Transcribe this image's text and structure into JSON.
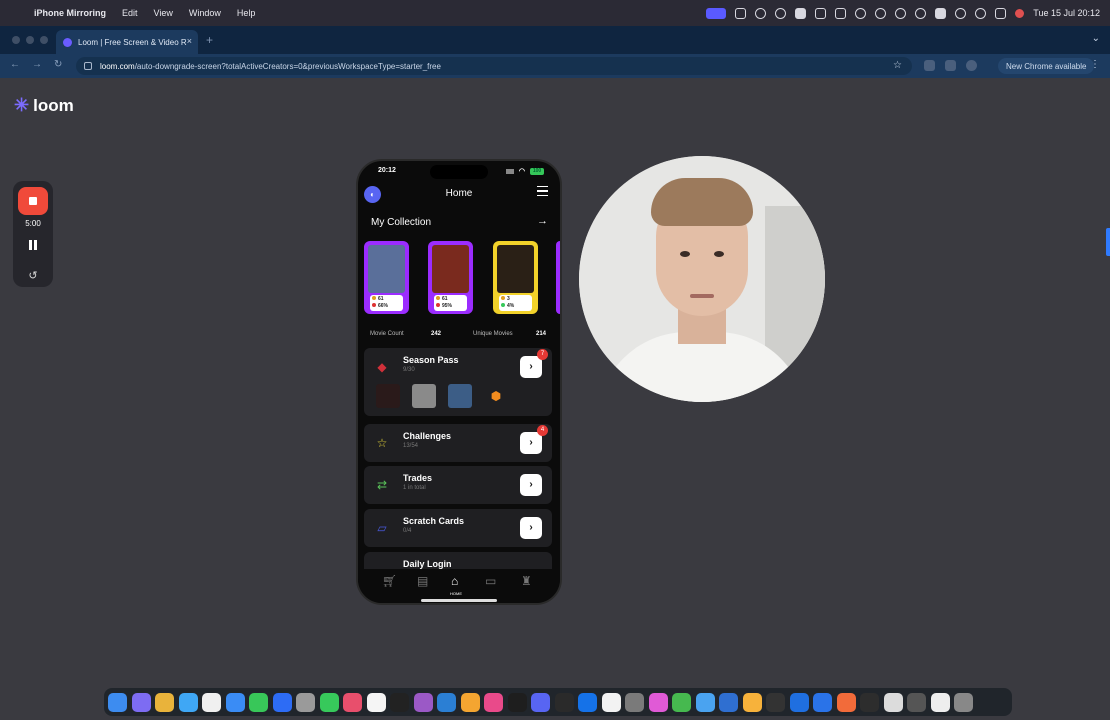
{
  "menubar": {
    "apple_icon": "apple-icon",
    "app_name": "iPhone Mirroring",
    "menus": [
      "Edit",
      "View",
      "Window",
      "Help"
    ],
    "clock": "Tue 15 Jul  20:12"
  },
  "browser": {
    "tab_title": "Loom | Free Screen & Video R",
    "tab_close": "×",
    "new_tab": "+",
    "url_domain": "loom.com",
    "url_path": "/auto-downgrade-screen?totalActiveCreators=0&previousWorkspaceType=starter_free",
    "update_label": "New Chrome available",
    "nav_back": "←",
    "nav_forward": "→",
    "nav_reload": "↻",
    "bookmark_star": "☆",
    "menu_kebab": "⋮"
  },
  "loom": {
    "brand": "loom",
    "timer": "5:00",
    "restart_glyph": "↺"
  },
  "phone": {
    "status_time": "20:12",
    "battery": "100",
    "header_title": "Home",
    "collection_title": "My Collection",
    "collection_arrow": "→",
    "cards": [
      {
        "line1": "61",
        "line2": "66%",
        "border": "#9b2cff",
        "accent": "#e0a020"
      },
      {
        "line1": "61",
        "line2": "95%",
        "border": "#9b2cff",
        "accent": "#e0a020"
      },
      {
        "line1": "3",
        "line2": "4%",
        "border": "#f2d22a",
        "accent": "#37c95b"
      }
    ],
    "movie_count_label": "Movie Count",
    "movie_count_value": "242",
    "unique_movies_label": "Unique Movies",
    "unique_movies_value": "214",
    "menu": [
      {
        "label": "Season Pass",
        "sub": "9/30",
        "badge": "7",
        "icon": "ticket-icon"
      },
      {
        "label": "Challenges",
        "sub": "13/54",
        "badge": "4",
        "icon": "star-icon"
      },
      {
        "label": "Trades",
        "sub": "1 in total",
        "badge": "",
        "icon": "trade-arrows-icon"
      },
      {
        "label": "Scratch Cards",
        "sub": "0/4",
        "badge": "",
        "icon": "scratch-card-icon"
      },
      {
        "label": "Daily Login",
        "sub": "",
        "badge": "",
        "icon": "calendar-icon"
      }
    ],
    "go_glyph": "›",
    "tabbar": {
      "home_label": "HOME"
    }
  },
  "colors": {
    "loom_purple": "#7c6cff",
    "stop_red": "#f04a3a",
    "badge_red": "#e53935",
    "discord_blue": "#5865f2"
  }
}
